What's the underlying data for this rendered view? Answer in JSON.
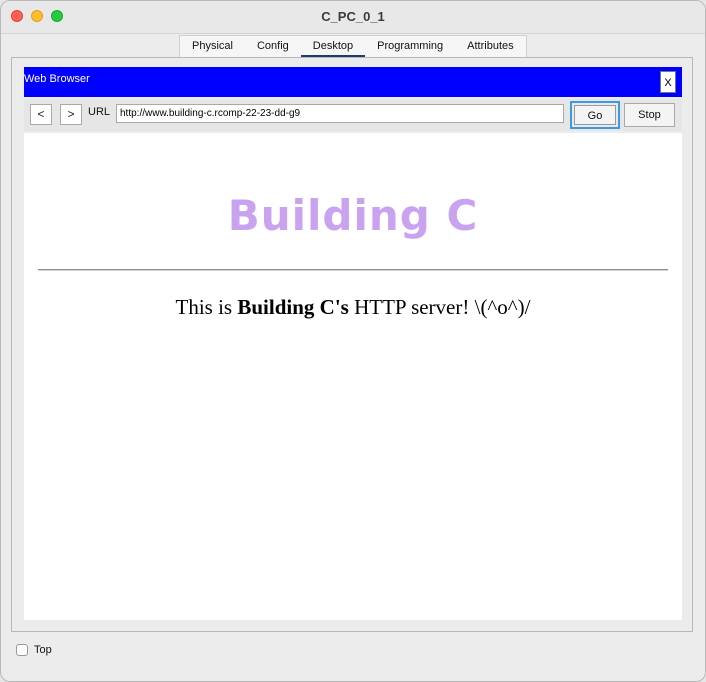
{
  "window": {
    "title": "C_PC_0_1"
  },
  "tabs": [
    {
      "label": "Physical"
    },
    {
      "label": "Config"
    },
    {
      "label": "Desktop"
    },
    {
      "label": "Programming"
    },
    {
      "label": "Attributes"
    }
  ],
  "active_tab": "Desktop",
  "web_browser": {
    "title": "Web Browser",
    "close_label": "X",
    "back_label": "<",
    "forward_label": ">",
    "url_label": "URL",
    "url_value": "http://www.building-c.rcomp-22-23-dd-g9",
    "go_label": "Go",
    "stop_label": "Stop"
  },
  "page": {
    "heading": "Building C",
    "text_before": "This is ",
    "text_bold": "Building C's",
    "text_after": " HTTP server! \\(^o^)/"
  },
  "footer": {
    "top_label": "Top",
    "top_checked": false
  },
  "colors": {
    "browser_header": "#0000ff",
    "heading": "#c9a2f0",
    "active_tab_underline": "#1f3b73"
  }
}
